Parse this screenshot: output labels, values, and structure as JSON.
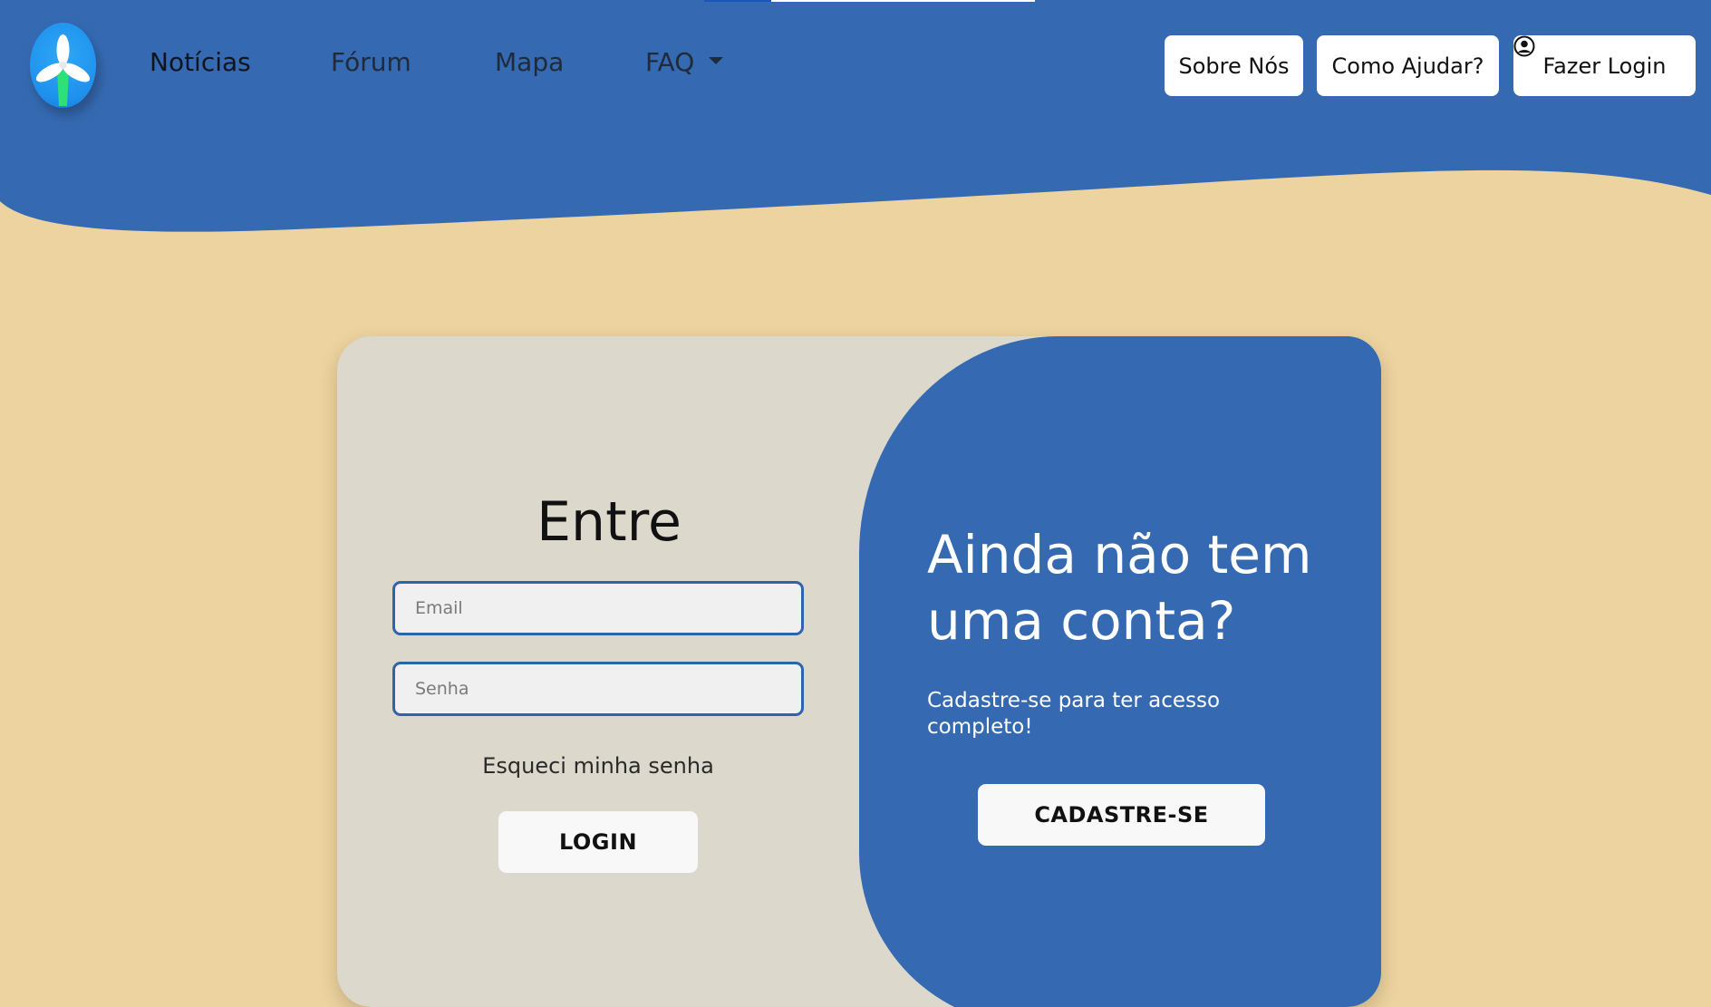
{
  "header": {
    "logo_icon": "windmill-logo-icon",
    "nav": [
      {
        "label": "Notícias",
        "active": true
      },
      {
        "label": "Fórum",
        "active": false
      },
      {
        "label": "Mapa",
        "active": false
      },
      {
        "label": "FAQ",
        "active": false,
        "dropdown": true
      }
    ],
    "buttons": {
      "about": "Sobre Nós",
      "help": "Como Ajudar?",
      "login": "Fazer Login",
      "login_icon": "user-circle-icon"
    }
  },
  "login_form": {
    "title": "Entre",
    "email_placeholder": "Email",
    "email_value": "",
    "password_placeholder": "Senha",
    "password_value": "",
    "forgot_link": "Esqueci minha senha",
    "submit_label": "LOGIN"
  },
  "signup_panel": {
    "title": "Ainda não tem uma conta?",
    "subtitle": "Cadastre-se para ter acesso completo!",
    "button_label": "CADASTRE-SE"
  },
  "colors": {
    "primary_blue": "#356AB2",
    "sand_background": "#EDD39F",
    "card_gray": "#DCD8CC",
    "input_border": "#2E63AD"
  }
}
